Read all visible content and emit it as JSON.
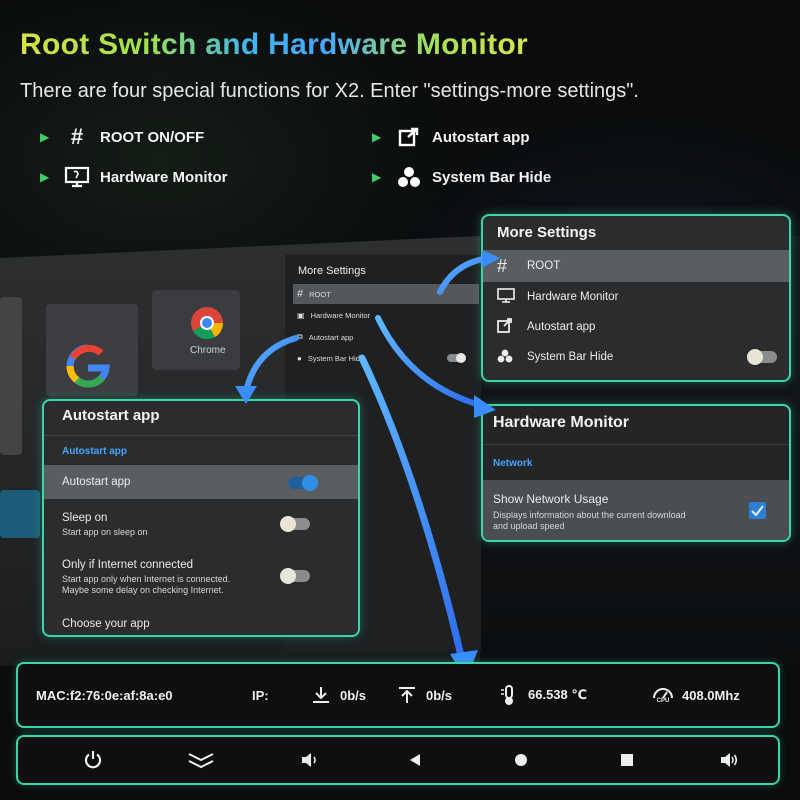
{
  "header": {
    "title": "Root Switch and Hardware Monitor",
    "subtitle": "There are four special functions for X2.  Enter \"settings-more settings\"."
  },
  "features": [
    {
      "label": "ROOT ON/OFF",
      "icon": "hash-icon"
    },
    {
      "label": "Autostart app",
      "icon": "external-link-icon"
    },
    {
      "label": "Hardware Monitor",
      "icon": "monitor-icon"
    },
    {
      "label": "System Bar Hide",
      "icon": "cubes-icon"
    }
  ],
  "tv_scene": {
    "chrome_label": "Chrome",
    "more_settings": {
      "title": "More Settings",
      "items": [
        "ROOT",
        "Hardware Monitor",
        "Autostart app",
        "System Bar Hide"
      ]
    }
  },
  "more_settings_panel": {
    "title": "More Settings",
    "items": [
      {
        "label": "ROOT",
        "icon": "hash-icon",
        "selected": true
      },
      {
        "label": "Hardware Monitor",
        "icon": "monitor-icon",
        "selected": false
      },
      {
        "label": "Autostart app",
        "icon": "external-link-icon",
        "selected": false
      },
      {
        "label": "System Bar Hide",
        "icon": "cubes-icon",
        "selected": false,
        "toggle": "off"
      }
    ]
  },
  "autostart_panel": {
    "title": "Autostart app",
    "section": "Autostart app",
    "rows": [
      {
        "label": "Autostart app",
        "toggle": "on"
      },
      {
        "label": "Sleep on",
        "desc": "Start app on sleep on",
        "toggle": "off"
      },
      {
        "label": "Only if Internet connected",
        "desc": "Start app only when Internet is connected.",
        "desc2": "Maybe some delay on checking Internet.",
        "toggle": "off"
      },
      {
        "label": "Choose your app"
      }
    ]
  },
  "hardware_panel": {
    "title": "Hardware Monitor",
    "section": "Network",
    "option": {
      "label": "Show Network Usage",
      "desc": "Displays information about the current download",
      "desc2": "and upload speed",
      "checked": true
    }
  },
  "status_bar": {
    "mac": "MAC:f2:76:0e:af:8a:e0",
    "ip_label": "IP:",
    "download": "0b/s",
    "upload": "0b/s",
    "temperature": "66.538 ℃",
    "cpu_freq": "408.0Mhz",
    "cpu_icon_label": "CPU"
  },
  "nav_bar": {
    "buttons": [
      "power-icon",
      "collapse-icon",
      "volume-down-icon",
      "back-icon",
      "home-icon",
      "recents-icon",
      "volume-up-icon"
    ]
  },
  "colors": {
    "accent_border": "#39d7a5",
    "link_blue": "#48a4ff",
    "bullet_green": "#3ecf6a",
    "toggle_on": "#2f8fe6",
    "arrow_blue": "#3a8dff"
  }
}
